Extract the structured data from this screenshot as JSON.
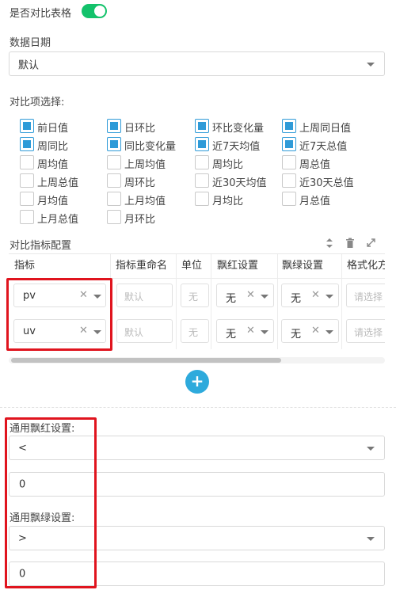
{
  "compare_table": {
    "label": "是否对比表格",
    "enabled": true
  },
  "data_date": {
    "label": "数据日期",
    "value": "默认"
  },
  "compare_items": {
    "label": "对比项选择:",
    "options": [
      {
        "label": "前日值",
        "checked": true
      },
      {
        "label": "日环比",
        "checked": true
      },
      {
        "label": "环比变化量",
        "checked": true
      },
      {
        "label": "上周同日值",
        "checked": true
      },
      {
        "label": "周同比",
        "checked": true
      },
      {
        "label": "同比变化量",
        "checked": true
      },
      {
        "label": "近7天均值",
        "checked": true
      },
      {
        "label": "近7天总值",
        "checked": true
      },
      {
        "label": "周均值",
        "checked": false
      },
      {
        "label": "上周均值",
        "checked": false
      },
      {
        "label": "周均比",
        "checked": false
      },
      {
        "label": "周总值",
        "checked": false
      },
      {
        "label": "上周总值",
        "checked": false
      },
      {
        "label": "周环比",
        "checked": false
      },
      {
        "label": "近30天均值",
        "checked": false
      },
      {
        "label": "近30天总值",
        "checked": false
      },
      {
        "label": "月均值",
        "checked": false
      },
      {
        "label": "上月均值",
        "checked": false
      },
      {
        "label": "月均比",
        "checked": false
      },
      {
        "label": "月总值",
        "checked": false
      },
      {
        "label": "上月总值",
        "checked": false
      },
      {
        "label": "月环比",
        "checked": false
      }
    ]
  },
  "metric_config": {
    "label": "对比指标配置",
    "columns": [
      "指标",
      "指标重命名",
      "单位",
      "飘红设置",
      "飘绿设置",
      "格式化方"
    ],
    "rows": [
      {
        "metric": "pv",
        "rename_placeholder": "默认",
        "unit_placeholder": "无",
        "red": "无",
        "green": "无",
        "format_placeholder": "请选择"
      },
      {
        "metric": "uv",
        "rename_placeholder": "默认",
        "unit_placeholder": "无",
        "red": "无",
        "green": "无",
        "format_placeholder": "请选择"
      }
    ],
    "add_label": "+"
  },
  "general_red": {
    "label": "通用飘红设置:",
    "operator": "<",
    "value": "0"
  },
  "general_green": {
    "label": "通用飘绿设置:",
    "operator": ">",
    "value": "0"
  }
}
